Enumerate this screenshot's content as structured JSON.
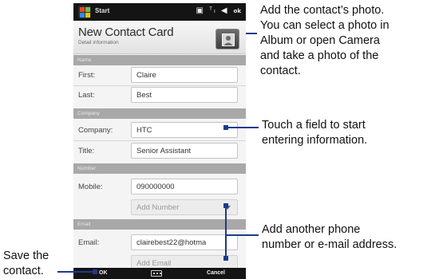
{
  "statusbar": {
    "start_label": "Start",
    "icons": "▣ ᵀₗ ◀ ",
    "ok": "ok"
  },
  "header": {
    "title": "New Contact Card",
    "subtitle": "Detail information"
  },
  "sections": {
    "name": "Name",
    "company": "Company",
    "number": "Number",
    "email": "Email"
  },
  "fields": {
    "first": {
      "label": "First:",
      "value": "Claire"
    },
    "last": {
      "label": "Last:",
      "value": "Best"
    },
    "company": {
      "label": "Company:",
      "value": "HTC"
    },
    "title": {
      "label": "Title:",
      "value": "Senior Assistant"
    },
    "mobile": {
      "label": "Mobile:",
      "value": "090000000"
    },
    "add_number": "Add Number",
    "email": {
      "label": "Email:",
      "value": "clairebest22@hotma"
    },
    "add_email": "Add Email"
  },
  "softkeys": {
    "left": "OK",
    "right": "Cancel"
  },
  "callouts": {
    "photo": [
      "Add the contact’s photo.",
      "You can select a photo in",
      "Album or open Camera",
      "and take a photo of the",
      "contact."
    ],
    "field": [
      "Touch a field to start",
      "entering information."
    ],
    "add": [
      "Add another phone",
      "number or e-mail address."
    ],
    "save": [
      "Save the",
      "contact."
    ]
  },
  "colors": {
    "callout_line": "#1f3a8a",
    "titlebar": "#141414",
    "section": "#a8a8a8"
  }
}
